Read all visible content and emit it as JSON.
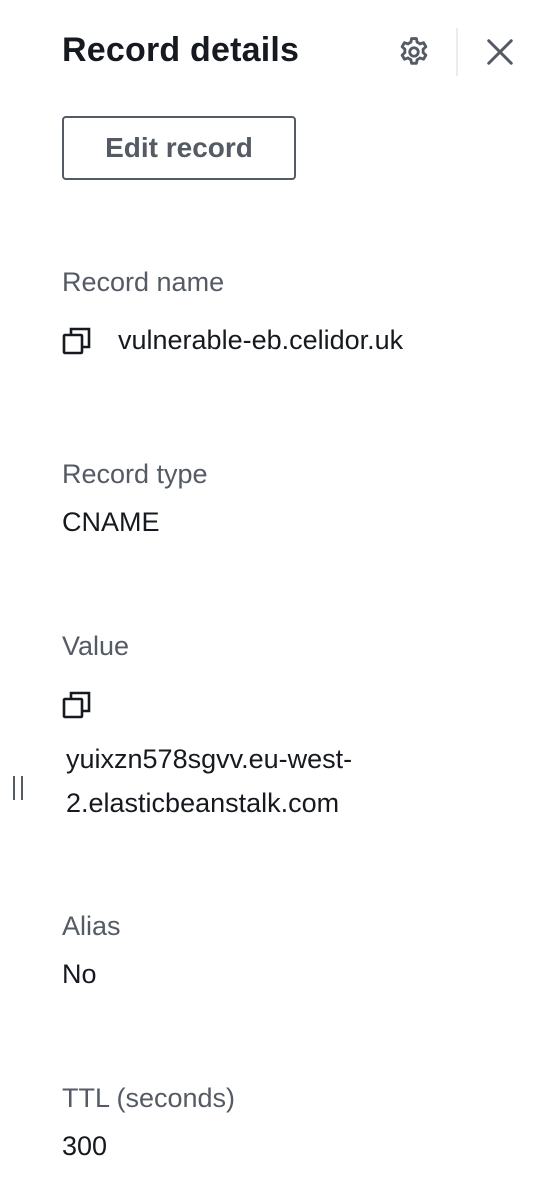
{
  "panel": {
    "title": "Record details",
    "settings_icon": "gear-icon",
    "close_icon": "close-icon"
  },
  "actions": {
    "edit_label": "Edit record"
  },
  "fields": {
    "record_name": {
      "label": "Record name",
      "value": "vulnerable-eb.celidor.uk",
      "copy_icon": "copy-icon"
    },
    "record_type": {
      "label": "Record type",
      "value": "CNAME"
    },
    "value": {
      "label": "Value",
      "copy_icon": "copy-icon",
      "line1": "yuixzn578sgvv.eu-west-",
      "line2": "2.elasticbeanstalk.com"
    },
    "alias": {
      "label": "Alias",
      "value": "No"
    },
    "ttl": {
      "label": "TTL (seconds)",
      "value": "300"
    }
  },
  "colors": {
    "text_primary": "#16191f",
    "text_secondary": "#545b64",
    "divider": "#e9ebed",
    "background": "#ffffff"
  }
}
